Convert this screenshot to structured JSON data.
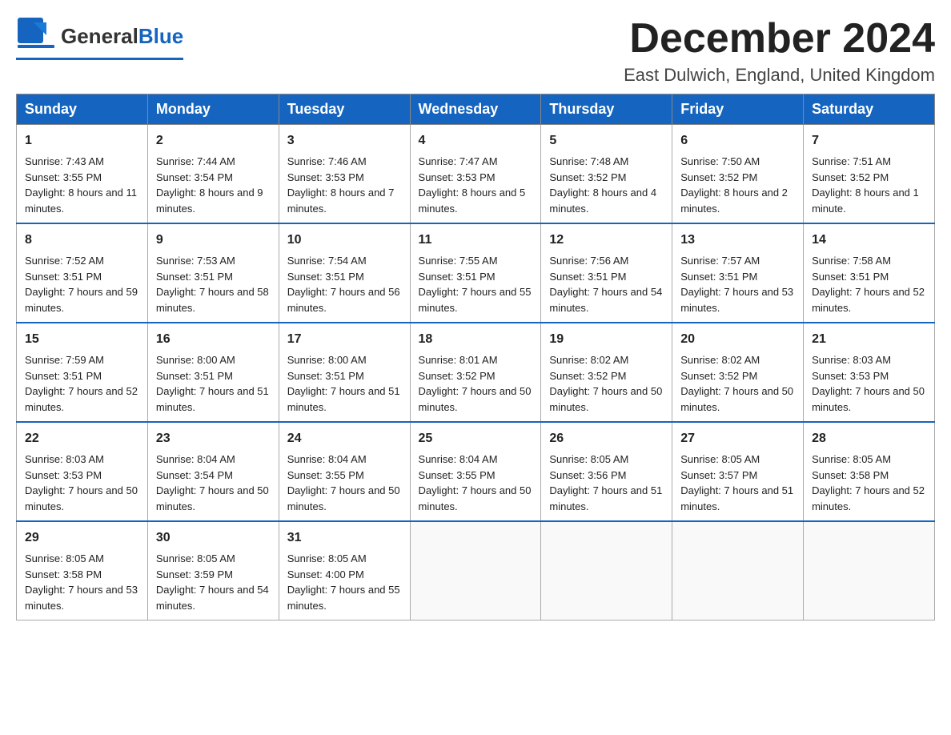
{
  "header": {
    "logo_general": "General",
    "logo_blue": "Blue",
    "month_title": "December 2024",
    "location": "East Dulwich, England, United Kingdom"
  },
  "weekdays": [
    "Sunday",
    "Monday",
    "Tuesday",
    "Wednesday",
    "Thursday",
    "Friday",
    "Saturday"
  ],
  "weeks": [
    [
      {
        "day": "1",
        "sunrise": "7:43 AM",
        "sunset": "3:55 PM",
        "daylight": "8 hours and 11 minutes."
      },
      {
        "day": "2",
        "sunrise": "7:44 AM",
        "sunset": "3:54 PM",
        "daylight": "8 hours and 9 minutes."
      },
      {
        "day": "3",
        "sunrise": "7:46 AM",
        "sunset": "3:53 PM",
        "daylight": "8 hours and 7 minutes."
      },
      {
        "day": "4",
        "sunrise": "7:47 AM",
        "sunset": "3:53 PM",
        "daylight": "8 hours and 5 minutes."
      },
      {
        "day": "5",
        "sunrise": "7:48 AM",
        "sunset": "3:52 PM",
        "daylight": "8 hours and 4 minutes."
      },
      {
        "day": "6",
        "sunrise": "7:50 AM",
        "sunset": "3:52 PM",
        "daylight": "8 hours and 2 minutes."
      },
      {
        "day": "7",
        "sunrise": "7:51 AM",
        "sunset": "3:52 PM",
        "daylight": "8 hours and 1 minute."
      }
    ],
    [
      {
        "day": "8",
        "sunrise": "7:52 AM",
        "sunset": "3:51 PM",
        "daylight": "7 hours and 59 minutes."
      },
      {
        "day": "9",
        "sunrise": "7:53 AM",
        "sunset": "3:51 PM",
        "daylight": "7 hours and 58 minutes."
      },
      {
        "day": "10",
        "sunrise": "7:54 AM",
        "sunset": "3:51 PM",
        "daylight": "7 hours and 56 minutes."
      },
      {
        "day": "11",
        "sunrise": "7:55 AM",
        "sunset": "3:51 PM",
        "daylight": "7 hours and 55 minutes."
      },
      {
        "day": "12",
        "sunrise": "7:56 AM",
        "sunset": "3:51 PM",
        "daylight": "7 hours and 54 minutes."
      },
      {
        "day": "13",
        "sunrise": "7:57 AM",
        "sunset": "3:51 PM",
        "daylight": "7 hours and 53 minutes."
      },
      {
        "day": "14",
        "sunrise": "7:58 AM",
        "sunset": "3:51 PM",
        "daylight": "7 hours and 52 minutes."
      }
    ],
    [
      {
        "day": "15",
        "sunrise": "7:59 AM",
        "sunset": "3:51 PM",
        "daylight": "7 hours and 52 minutes."
      },
      {
        "day": "16",
        "sunrise": "8:00 AM",
        "sunset": "3:51 PM",
        "daylight": "7 hours and 51 minutes."
      },
      {
        "day": "17",
        "sunrise": "8:00 AM",
        "sunset": "3:51 PM",
        "daylight": "7 hours and 51 minutes."
      },
      {
        "day": "18",
        "sunrise": "8:01 AM",
        "sunset": "3:52 PM",
        "daylight": "7 hours and 50 minutes."
      },
      {
        "day": "19",
        "sunrise": "8:02 AM",
        "sunset": "3:52 PM",
        "daylight": "7 hours and 50 minutes."
      },
      {
        "day": "20",
        "sunrise": "8:02 AM",
        "sunset": "3:52 PM",
        "daylight": "7 hours and 50 minutes."
      },
      {
        "day": "21",
        "sunrise": "8:03 AM",
        "sunset": "3:53 PM",
        "daylight": "7 hours and 50 minutes."
      }
    ],
    [
      {
        "day": "22",
        "sunrise": "8:03 AM",
        "sunset": "3:53 PM",
        "daylight": "7 hours and 50 minutes."
      },
      {
        "day": "23",
        "sunrise": "8:04 AM",
        "sunset": "3:54 PM",
        "daylight": "7 hours and 50 minutes."
      },
      {
        "day": "24",
        "sunrise": "8:04 AM",
        "sunset": "3:55 PM",
        "daylight": "7 hours and 50 minutes."
      },
      {
        "day": "25",
        "sunrise": "8:04 AM",
        "sunset": "3:55 PM",
        "daylight": "7 hours and 50 minutes."
      },
      {
        "day": "26",
        "sunrise": "8:05 AM",
        "sunset": "3:56 PM",
        "daylight": "7 hours and 51 minutes."
      },
      {
        "day": "27",
        "sunrise": "8:05 AM",
        "sunset": "3:57 PM",
        "daylight": "7 hours and 51 minutes."
      },
      {
        "day": "28",
        "sunrise": "8:05 AM",
        "sunset": "3:58 PM",
        "daylight": "7 hours and 52 minutes."
      }
    ],
    [
      {
        "day": "29",
        "sunrise": "8:05 AM",
        "sunset": "3:58 PM",
        "daylight": "7 hours and 53 minutes."
      },
      {
        "day": "30",
        "sunrise": "8:05 AM",
        "sunset": "3:59 PM",
        "daylight": "7 hours and 54 minutes."
      },
      {
        "day": "31",
        "sunrise": "8:05 AM",
        "sunset": "4:00 PM",
        "daylight": "7 hours and 55 minutes."
      },
      null,
      null,
      null,
      null
    ]
  ]
}
